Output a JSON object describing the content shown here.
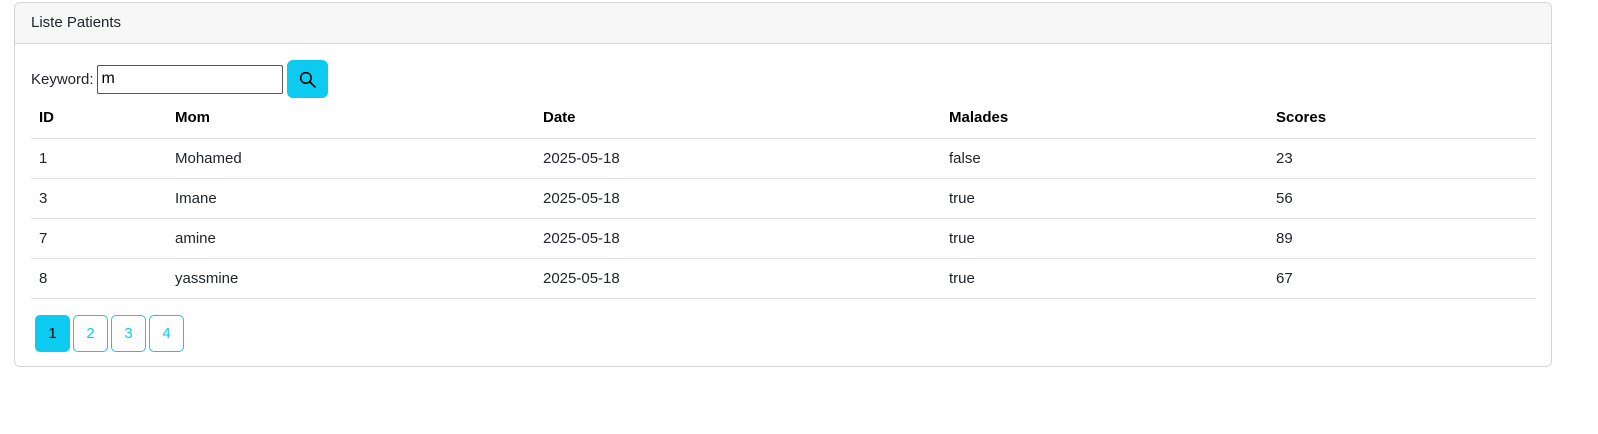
{
  "header": {
    "title": "Liste Patients"
  },
  "search": {
    "label": "Keyword:",
    "value": "m",
    "button_icon": "search-icon"
  },
  "table": {
    "columns": [
      "ID",
      "Mom",
      "Date",
      "Malades",
      "Scores"
    ],
    "rows": [
      [
        "1",
        "Mohamed",
        "2025-05-18",
        "false",
        "23"
      ],
      [
        "3",
        "Imane",
        "2025-05-18",
        "true",
        "56"
      ],
      [
        "7",
        "amine",
        "2025-05-18",
        "true",
        "89"
      ],
      [
        "8",
        "yassmine",
        "2025-05-18",
        "true",
        "67"
      ]
    ]
  },
  "pagination": {
    "pages": [
      "1",
      "2",
      "3",
      "4"
    ],
    "current": "1"
  },
  "colors": {
    "accent": "#0dcaf0"
  }
}
